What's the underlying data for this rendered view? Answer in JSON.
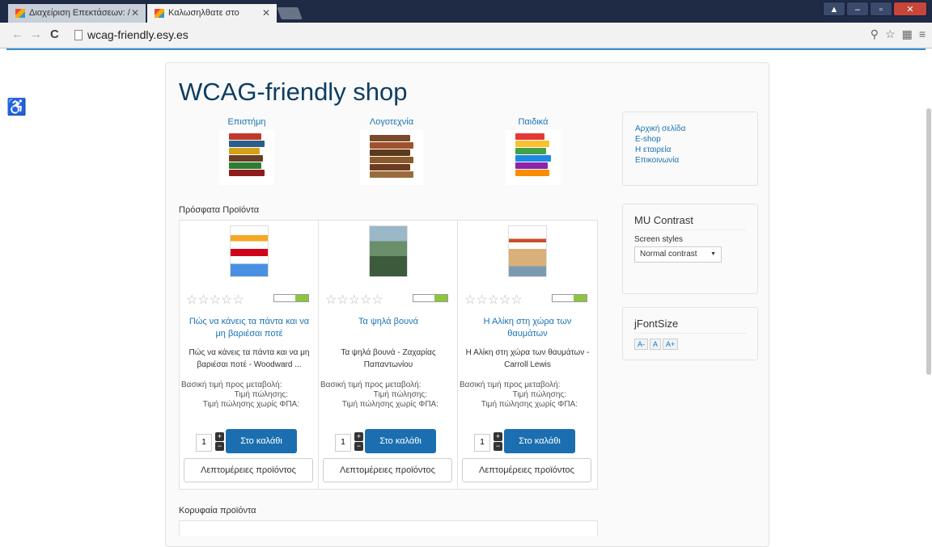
{
  "browser": {
    "tabs": [
      {
        "title": "Διαχείριση Επεκτάσεων: / "
      },
      {
        "title": "Καλωσηλθατε στο"
      }
    ],
    "url": "wcag-friendly.esy.es"
  },
  "site": {
    "title": "WCAG-friendly shop",
    "categories": [
      {
        "label": "Επιστήμη"
      },
      {
        "label": "Λογοτεχνία"
      },
      {
        "label": "Παιδικά"
      }
    ],
    "recent_heading": "Πρόσφατα Προϊόντα",
    "top_heading": "Κορυφαία προϊόντα",
    "products": [
      {
        "name": "Πώς να κάνεις τα πάντα και να μη βαριέσαι ποτέ",
        "desc": "Πώς να κάνεις τα πάντα και να μη βαριέσαι ποτέ - Woodward ...",
        "qty": "1"
      },
      {
        "name": "Τα ψηλά βουνά",
        "desc": "Τα ψηλά βουνά - Ζαχαρίας Παπαντωνίου",
        "qty": "1"
      },
      {
        "name": "Η Αλίκη στη χώρα των θαυμάτων",
        "desc": "Η Αλίκη στη χώρα των θαυμάτων - Carroll Lewis",
        "qty": "1"
      }
    ],
    "price_labels": {
      "base": "Βασική τιμή προς μεταβολή:",
      "sale": "Τιμή πώλησης:",
      "net": "Τιμή πώλησης χωρίς ΦΠΑ:"
    },
    "cart_label": "Στο καλάθι",
    "details_label": "Λεπτομέρειες προϊόντος",
    "menu": [
      "Αρχική σελίδα",
      "E-shop",
      "Η εταιρεία",
      "Επικοινωνία"
    ],
    "contrast": {
      "heading": "MU Contrast",
      "label": "Screen styles",
      "selected": "Normal contrast"
    },
    "fontsize": {
      "heading": "jFontSize",
      "buttons": [
        "A-",
        "A",
        "A+"
      ]
    }
  }
}
